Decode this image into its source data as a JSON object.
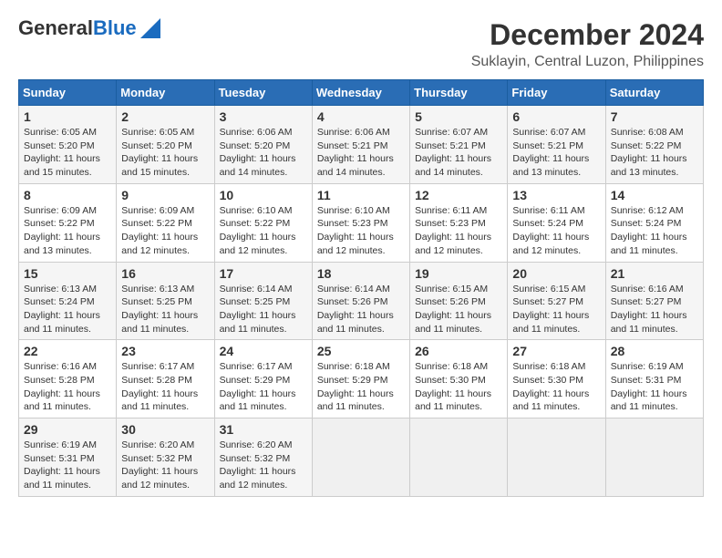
{
  "header": {
    "logo_line1": "General",
    "logo_line2": "Blue",
    "title": "December 2024",
    "subtitle": "Suklayin, Central Luzon, Philippines"
  },
  "calendar": {
    "headers": [
      "Sunday",
      "Monday",
      "Tuesday",
      "Wednesday",
      "Thursday",
      "Friday",
      "Saturday"
    ],
    "weeks": [
      [
        {
          "day": "",
          "info": ""
        },
        {
          "day": "2",
          "info": "Sunrise: 6:05 AM\nSunset: 5:20 PM\nDaylight: 11 hours and 15 minutes."
        },
        {
          "day": "3",
          "info": "Sunrise: 6:06 AM\nSunset: 5:20 PM\nDaylight: 11 hours and 14 minutes."
        },
        {
          "day": "4",
          "info": "Sunrise: 6:06 AM\nSunset: 5:21 PM\nDaylight: 11 hours and 14 minutes."
        },
        {
          "day": "5",
          "info": "Sunrise: 6:07 AM\nSunset: 5:21 PM\nDaylight: 11 hours and 14 minutes."
        },
        {
          "day": "6",
          "info": "Sunrise: 6:07 AM\nSunset: 5:21 PM\nDaylight: 11 hours and 13 minutes."
        },
        {
          "day": "7",
          "info": "Sunrise: 6:08 AM\nSunset: 5:22 PM\nDaylight: 11 hours and 13 minutes."
        }
      ],
      [
        {
          "day": "1",
          "info": "Sunrise: 6:05 AM\nSunset: 5:20 PM\nDaylight: 11 hours and 15 minutes."
        },
        {
          "day": "9",
          "info": "Sunrise: 6:09 AM\nSunset: 5:22 PM\nDaylight: 11 hours and 12 minutes."
        },
        {
          "day": "10",
          "info": "Sunrise: 6:10 AM\nSunset: 5:22 PM\nDaylight: 11 hours and 12 minutes."
        },
        {
          "day": "11",
          "info": "Sunrise: 6:10 AM\nSunset: 5:23 PM\nDaylight: 11 hours and 12 minutes."
        },
        {
          "day": "12",
          "info": "Sunrise: 6:11 AM\nSunset: 5:23 PM\nDaylight: 11 hours and 12 minutes."
        },
        {
          "day": "13",
          "info": "Sunrise: 6:11 AM\nSunset: 5:24 PM\nDaylight: 11 hours and 12 minutes."
        },
        {
          "day": "14",
          "info": "Sunrise: 6:12 AM\nSunset: 5:24 PM\nDaylight: 11 hours and 11 minutes."
        }
      ],
      [
        {
          "day": "8",
          "info": "Sunrise: 6:09 AM\nSunset: 5:22 PM\nDaylight: 11 hours and 13 minutes."
        },
        {
          "day": "16",
          "info": "Sunrise: 6:13 AM\nSunset: 5:25 PM\nDaylight: 11 hours and 11 minutes."
        },
        {
          "day": "17",
          "info": "Sunrise: 6:14 AM\nSunset: 5:25 PM\nDaylight: 11 hours and 11 minutes."
        },
        {
          "day": "18",
          "info": "Sunrise: 6:14 AM\nSunset: 5:26 PM\nDaylight: 11 hours and 11 minutes."
        },
        {
          "day": "19",
          "info": "Sunrise: 6:15 AM\nSunset: 5:26 PM\nDaylight: 11 hours and 11 minutes."
        },
        {
          "day": "20",
          "info": "Sunrise: 6:15 AM\nSunset: 5:27 PM\nDaylight: 11 hours and 11 minutes."
        },
        {
          "day": "21",
          "info": "Sunrise: 6:16 AM\nSunset: 5:27 PM\nDaylight: 11 hours and 11 minutes."
        }
      ],
      [
        {
          "day": "15",
          "info": "Sunrise: 6:13 AM\nSunset: 5:24 PM\nDaylight: 11 hours and 11 minutes."
        },
        {
          "day": "23",
          "info": "Sunrise: 6:17 AM\nSunset: 5:28 PM\nDaylight: 11 hours and 11 minutes."
        },
        {
          "day": "24",
          "info": "Sunrise: 6:17 AM\nSunset: 5:29 PM\nDaylight: 11 hours and 11 minutes."
        },
        {
          "day": "25",
          "info": "Sunrise: 6:18 AM\nSunset: 5:29 PM\nDaylight: 11 hours and 11 minutes."
        },
        {
          "day": "26",
          "info": "Sunrise: 6:18 AM\nSunset: 5:30 PM\nDaylight: 11 hours and 11 minutes."
        },
        {
          "day": "27",
          "info": "Sunrise: 6:18 AM\nSunset: 5:30 PM\nDaylight: 11 hours and 11 minutes."
        },
        {
          "day": "28",
          "info": "Sunrise: 6:19 AM\nSunset: 5:31 PM\nDaylight: 11 hours and 11 minutes."
        }
      ],
      [
        {
          "day": "22",
          "info": "Sunrise: 6:16 AM\nSunset: 5:28 PM\nDaylight: 11 hours and 11 minutes."
        },
        {
          "day": "30",
          "info": "Sunrise: 6:20 AM\nSunset: 5:32 PM\nDaylight: 11 hours and 12 minutes."
        },
        {
          "day": "31",
          "info": "Sunrise: 6:20 AM\nSunset: 5:32 PM\nDaylight: 11 hours and 12 minutes."
        },
        {
          "day": "",
          "info": ""
        },
        {
          "day": "",
          "info": ""
        },
        {
          "day": "",
          "info": ""
        },
        {
          "day": "",
          "info": ""
        }
      ],
      [
        {
          "day": "29",
          "info": "Sunrise: 6:19 AM\nSunset: 5:31 PM\nDaylight: 11 hours and 11 minutes."
        },
        {
          "day": "",
          "info": ""
        },
        {
          "day": "",
          "info": ""
        },
        {
          "day": "",
          "info": ""
        },
        {
          "day": "",
          "info": ""
        },
        {
          "day": "",
          "info": ""
        },
        {
          "day": "",
          "info": ""
        }
      ]
    ]
  }
}
